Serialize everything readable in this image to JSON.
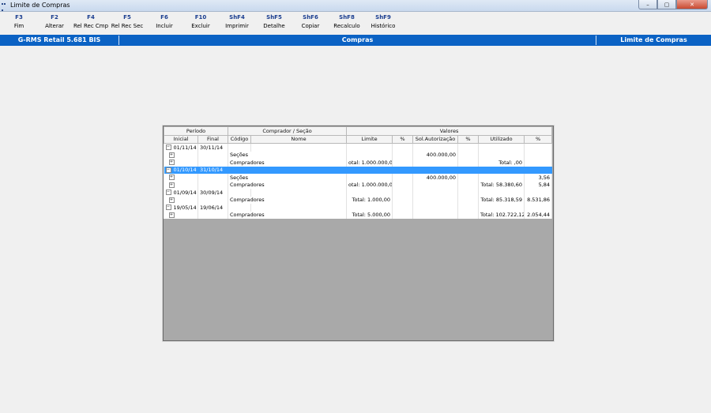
{
  "window": {
    "title": "Limite de Compras"
  },
  "window_buttons": {
    "minimize": "–",
    "maximize": "▢",
    "close": "✕"
  },
  "toolbar": [
    {
      "key": "F3",
      "label": "Fim"
    },
    {
      "key": "F2",
      "label": "Alterar"
    },
    {
      "key": "F4",
      "label": "Rel Rec Cmp"
    },
    {
      "key": "F5",
      "label": "Rel Rec Sec"
    },
    {
      "key": "F6",
      "label": "Incluir"
    },
    {
      "key": "F10",
      "label": "Excluir"
    },
    {
      "key": "ShF4",
      "label": "Imprimir"
    },
    {
      "key": "ShF5",
      "label": "Detalhe"
    },
    {
      "key": "ShF6",
      "label": "Copiar"
    },
    {
      "key": "ShF8",
      "label": "Recalculo"
    },
    {
      "key": "ShF9",
      "label": "Histórico"
    }
  ],
  "header": {
    "left": "G-RMS Retail 5.681 BIS",
    "center": "Compras",
    "right": "Limite de Compras"
  },
  "grid": {
    "groups": {
      "periodo": "Período",
      "comprador": "Comprador / Seção",
      "valores": "Valores"
    },
    "columns": [
      "Inicial",
      "Final",
      "Código",
      "Nome",
      "Limite",
      "%",
      "Sol.Autorização",
      "%",
      "Utilizado",
      "%"
    ],
    "rows": [
      {
        "type": "period",
        "expand": "−",
        "inicial": "01/11/14",
        "final": "30/11/14",
        "limite": "",
        "pct1": "",
        "sol": "",
        "pct2": "",
        "util": "",
        "pct3": "",
        "selected": false
      },
      {
        "type": "child",
        "expand": "+",
        "codigo": "Seções",
        "limite": "",
        "pct1": "",
        "sol": "400.000,00",
        "pct2": "",
        "util": "",
        "pct3": ""
      },
      {
        "type": "child",
        "expand": "+",
        "codigo": "Compradores",
        "limite": "otal: 1.000.000,00",
        "pct1": "",
        "sol": "",
        "pct2": "",
        "util": "Total: ,00",
        "pct3": ""
      },
      {
        "type": "period",
        "expand": "−",
        "inicial": "01/10/14",
        "final": "31/10/14",
        "limite": "",
        "pct1": "",
        "sol": "",
        "pct2": "",
        "util": "",
        "pct3": "",
        "selected": true
      },
      {
        "type": "child",
        "expand": "+",
        "codigo": "Seções",
        "limite": "",
        "pct1": "",
        "sol": "400.000,00",
        "pct2": "",
        "util": "",
        "pct3": "3,56"
      },
      {
        "type": "child",
        "expand": "+",
        "codigo": "Compradores",
        "limite": "otal: 1.000.000,00",
        "pct1": "",
        "sol": "",
        "pct2": "",
        "util": "Total: 58.380,60",
        "pct3": "5,84"
      },
      {
        "type": "period",
        "expand": "−",
        "inicial": "01/09/14",
        "final": "30/09/14",
        "limite": "",
        "pct1": "",
        "sol": "",
        "pct2": "",
        "util": "",
        "pct3": "",
        "selected": false
      },
      {
        "type": "child",
        "expand": "+",
        "codigo": "Compradores",
        "limite": "Total: 1.000,00",
        "pct1": "",
        "sol": "",
        "pct2": "",
        "util": "Total: 85.318,59",
        "pct3": "8.531,86"
      },
      {
        "type": "period",
        "expand": "−",
        "inicial": "19/05/14",
        "final": "19/06/14",
        "limite": "",
        "pct1": "",
        "sol": "",
        "pct2": "",
        "util": "",
        "pct3": "",
        "selected": false
      },
      {
        "type": "child",
        "expand": "+",
        "codigo": "Compradores",
        "limite": "Total: 5.000,00",
        "pct1": "",
        "sol": "",
        "pct2": "",
        "util": "Total: 102.722,12",
        "pct3": "2.054,44"
      }
    ]
  }
}
